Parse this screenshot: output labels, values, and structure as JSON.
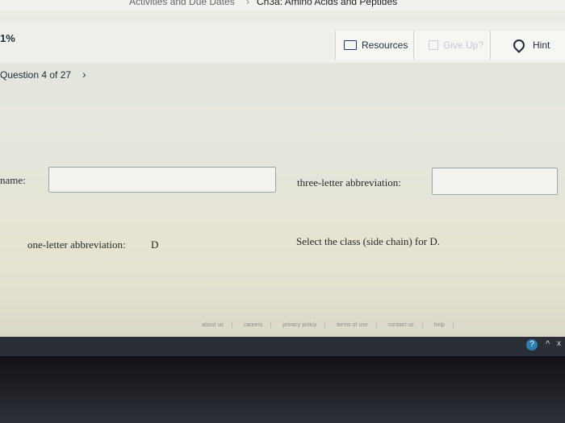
{
  "breadcrumb": {
    "parent": "Activities and Due Dates",
    "separator": "›",
    "current": "Ch3a: Amino Acids and Peptides"
  },
  "header": {
    "progress": "1%",
    "resources_label": "Resources",
    "giveup_label": "Give Up?",
    "hint_label": "Hint"
  },
  "question": {
    "counter": "Question 4 of 27",
    "next_glyph": "›"
  },
  "form": {
    "name_label": "name:",
    "name_value": "",
    "three_letter_label": "three-letter abbreviation:",
    "three_letter_value": "",
    "one_letter_label": "one-letter abbreviation:",
    "one_letter_value": "D",
    "class_prompt": "Select the class (side chain) for D."
  },
  "footer": {
    "links": [
      "about us",
      "careers",
      "privacy policy",
      "terms of use",
      "contact us",
      "help"
    ]
  },
  "taskbar": {
    "help_glyph": "?",
    "up_glyph": "^",
    "close_glyph": "x"
  },
  "colors": {
    "accent": "#1d3a6e",
    "background": "#e6e8e0"
  }
}
